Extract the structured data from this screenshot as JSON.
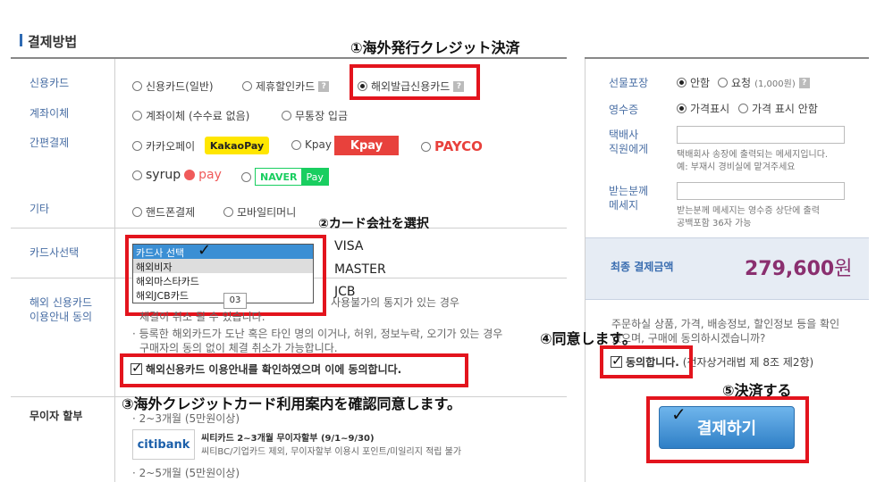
{
  "section_title": "결제방법",
  "annotations": {
    "a1": "①海外発行クレジット決済",
    "a2": "②カード会社を選択",
    "a3": "③海外クレジットカード利用案内を確認同意します。",
    "a4": "④同意します。",
    "a5": "⑤決済する"
  },
  "left_labels": {
    "credit": "신용카드",
    "transfer": "계좌이체",
    "simple": "간편결제",
    "other": "기타",
    "card_select": "카드사선택",
    "overseas_l1": "해외 신용카드",
    "overseas_l2": "이용안내 동의",
    "installment": "무이자 할부"
  },
  "payment_options": {
    "credit_general": "신용카드(일반)",
    "credit_partner": "제휴할인카드",
    "credit_overseas": "해외발급신용카드",
    "transfer_fee": "계좌이체 (수수료 없음)",
    "deposit": "무통장 입금",
    "kakaopay": "카카오페이",
    "kakaopay_logo": "KakaoPay",
    "kpay": "Kpay",
    "kpay_logo": "Kpay",
    "payco": "PAYCO",
    "syrup_a": "syrup",
    "syrup_b": "pay",
    "naver_a": "NAVER",
    "naver_b": "Pay",
    "phone": "핸드폰결제",
    "mobile_money": "모바일티머니"
  },
  "card_list": {
    "items": [
      "카드사 선택",
      "해외비자",
      "해외마스타카드",
      "해외JCB카드"
    ],
    "selected_index": 0,
    "tooltip": "03"
  },
  "card_brands": [
    "VISA",
    "MASTER",
    "JCB"
  ],
  "notice": {
    "line1_tail": "사용불가의 통지가 있는 경우",
    "line2": "체결이 취소 될 수 있습니다.",
    "line3": "· 등록한 해외카드가 도난 혹은 타인 명의 이거나, 허위, 정보누락, 오기가 있는 경우",
    "line4": "구매자의 동의 없이 체결 취소가 가능합니다.",
    "agree": "해외신용카드 이용안내를 확인하였으며 이에 동의합니다."
  },
  "installment": {
    "line1": "· 2~3개월 (5만원이상)",
    "bank_logo": "citibank",
    "title": "씨티카드 2~3개월 무이자할부 (9/1~9/30)",
    "desc": "씨티BC/기업카드 제외, 무이자할부 이용시 포인트/미일리지 적립 불가",
    "line2": "· 2~5개월 (5만원이상)"
  },
  "right_panel": {
    "gift_label": "선물포장",
    "gift_no": "안함",
    "gift_yes": "요청",
    "gift_fee": "(1,000원)",
    "receipt_label": "영수증",
    "receipt_show": "가격표시",
    "receipt_hide": "가격 표시 안함",
    "courier_l1": "택배사",
    "courier_l2": "직원에게",
    "courier_n1": "택배회사 송장에 출력되는 메세지입니다.",
    "courier_n2": "예: 부재시 경비실에 맡겨주세요",
    "recipient_l1": "받는분께",
    "recipient_l2": "메세지",
    "recipient_n1": "받는분께 메세지는 영수증 상단에 출력",
    "recipient_n2": "공백포함 36자 가능",
    "total_label": "최종 결제금액",
    "total_amount": "279,600",
    "total_unit": "원",
    "confirm_l1": "주문하실 상품, 가격, 배송정보, 할인정보 등을 확인",
    "confirm_l2": "였으며, 구매에 동의하시겠습니까?",
    "agree_text": "동의합니다.",
    "agree_law": "(전자상거래법 제 8조 제2항)",
    "pay_button": "결제하기"
  },
  "colors": {
    "highlight_red": "#e3141d",
    "label_blue": "#4a6fa5",
    "amount_purple": "#8a2f6f",
    "pay_button": "#3b8fd4",
    "kakao_yellow": "#ffe600",
    "kpay_red": "#e8413c",
    "payco_red": "#e8413c",
    "naver_green": "#19ce60",
    "syrup_red": "#f05a5a",
    "citi_blue": "#1b5faa"
  }
}
